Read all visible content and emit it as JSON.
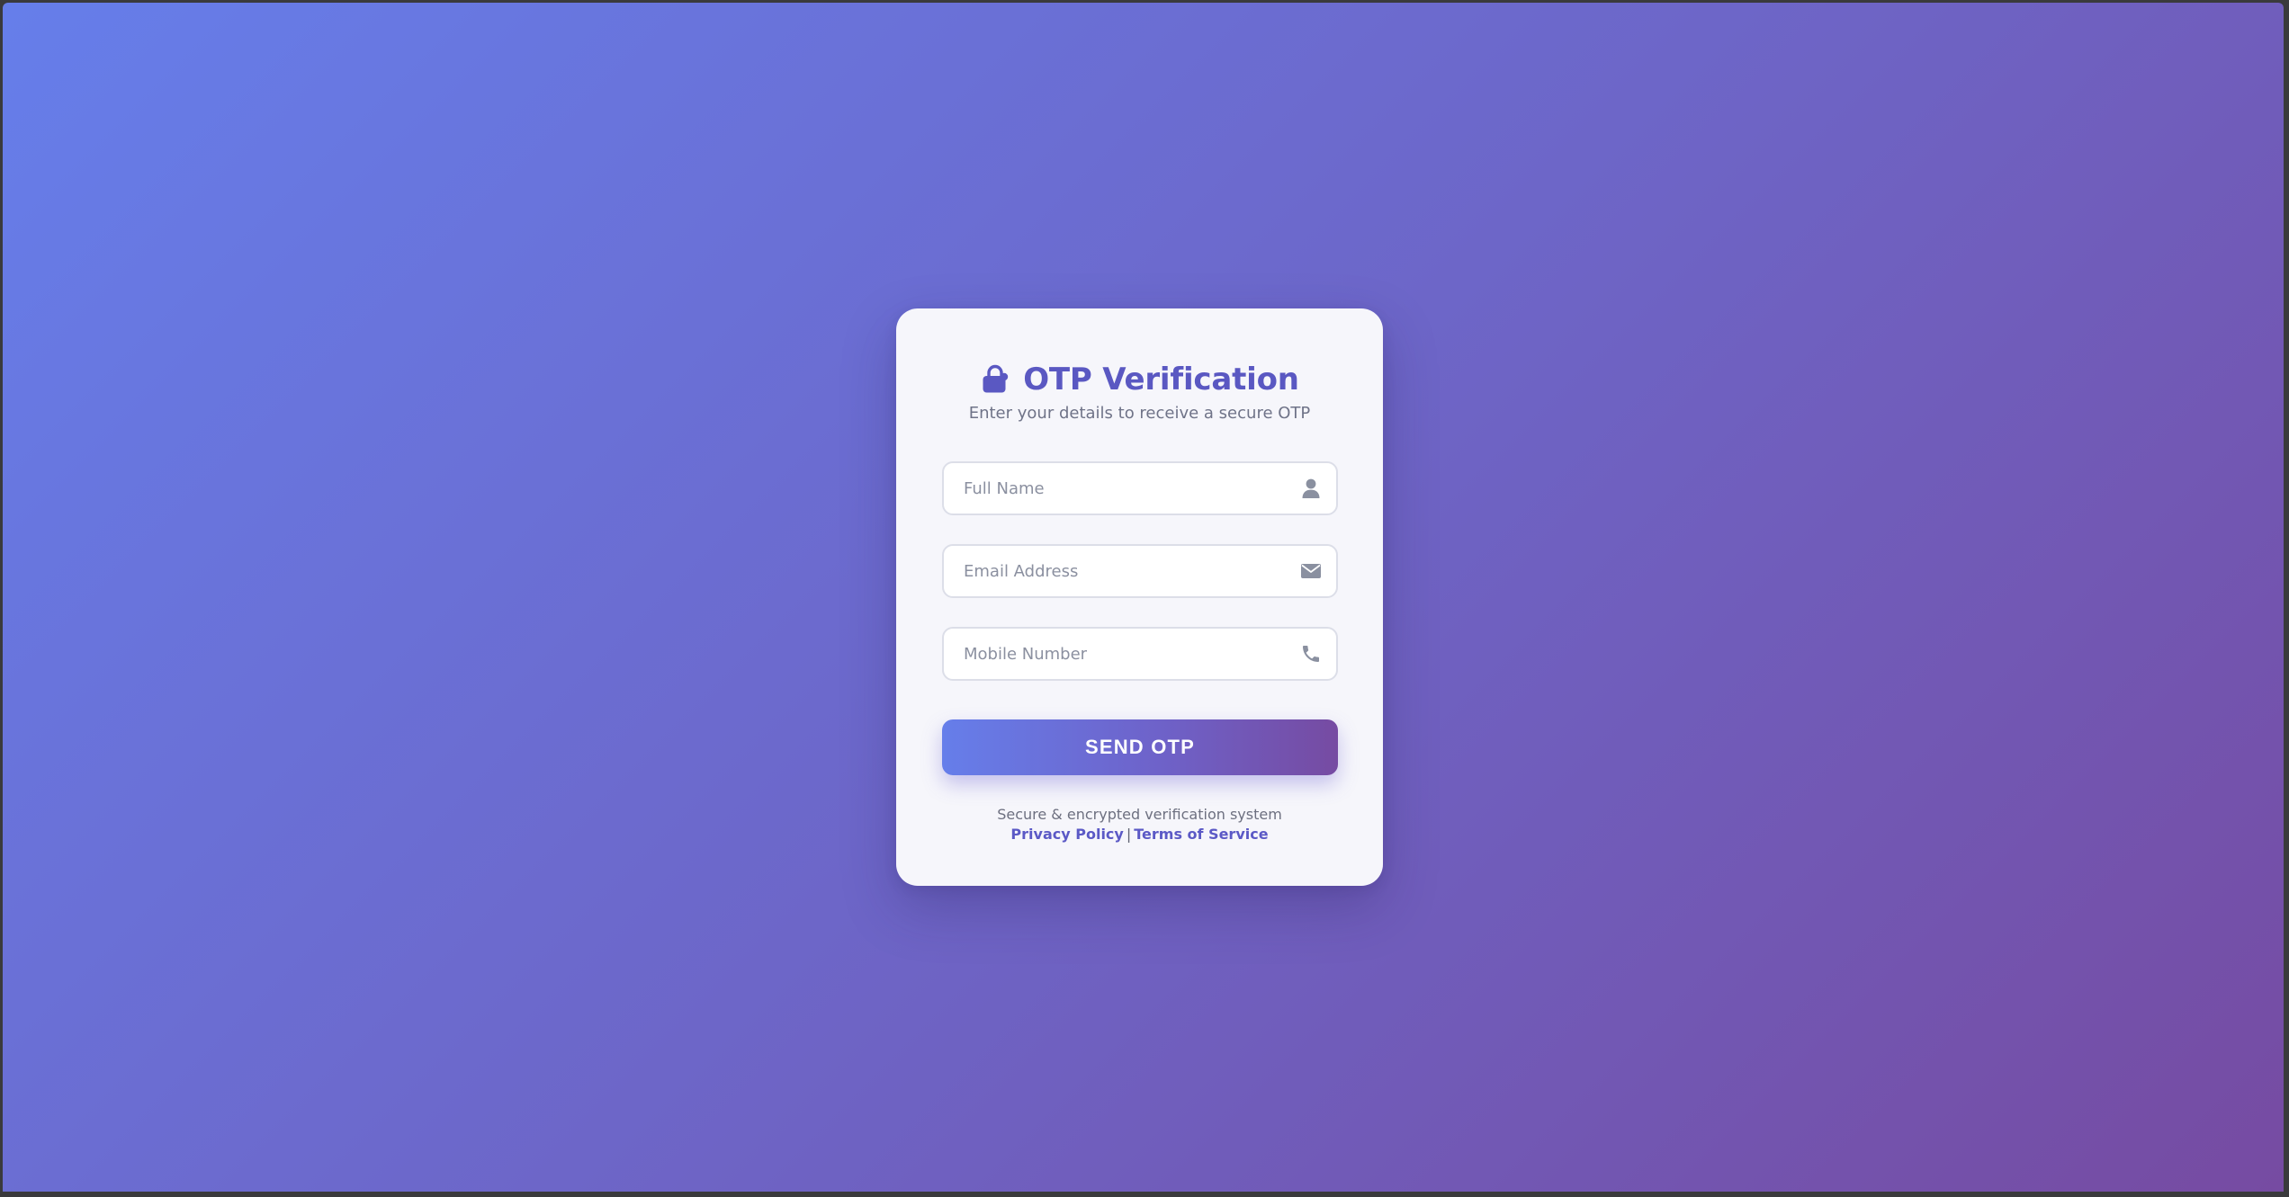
{
  "card": {
    "title": "OTP Verification",
    "title_icon": "lock-icon",
    "subtitle": "Enter your details to receive a secure OTP"
  },
  "form": {
    "full_name": {
      "placeholder": "Full Name",
      "value": "",
      "icon": "user-icon"
    },
    "email": {
      "placeholder": "Email Address",
      "value": "",
      "icon": "envelope-icon"
    },
    "mobile": {
      "placeholder": "Mobile Number",
      "value": "",
      "icon": "phone-icon"
    },
    "submit_label": "SEND OTP"
  },
  "footer": {
    "note": "Secure & encrypted verification system",
    "privacy_label": "Privacy Policy",
    "separator": "|",
    "terms_label": "Terms of Service"
  },
  "colors": {
    "gradient_start": "#667eea",
    "gradient_end": "#764ba2",
    "title": "#5a58c2",
    "link": "#5b59c6"
  }
}
